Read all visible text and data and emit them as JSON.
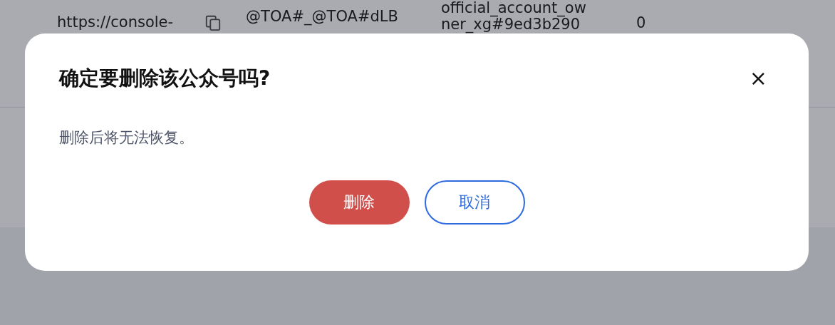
{
  "table_row": {
    "column_1": "https://console-",
    "column_2": "@TOA#_@TOA#dLB",
    "column_3": [
      "official_account_ow",
      "ner_xg#9ed3b290"
    ],
    "column_4": "0"
  },
  "dialog": {
    "title": "确定要删除该公众号吗?",
    "close": "×",
    "message": "删除后将无法恢复。",
    "buttons": [
      {
        "label": "删除",
        "kind": "danger"
      },
      {
        "label": "取消",
        "kind": "outline"
      }
    ]
  }
}
